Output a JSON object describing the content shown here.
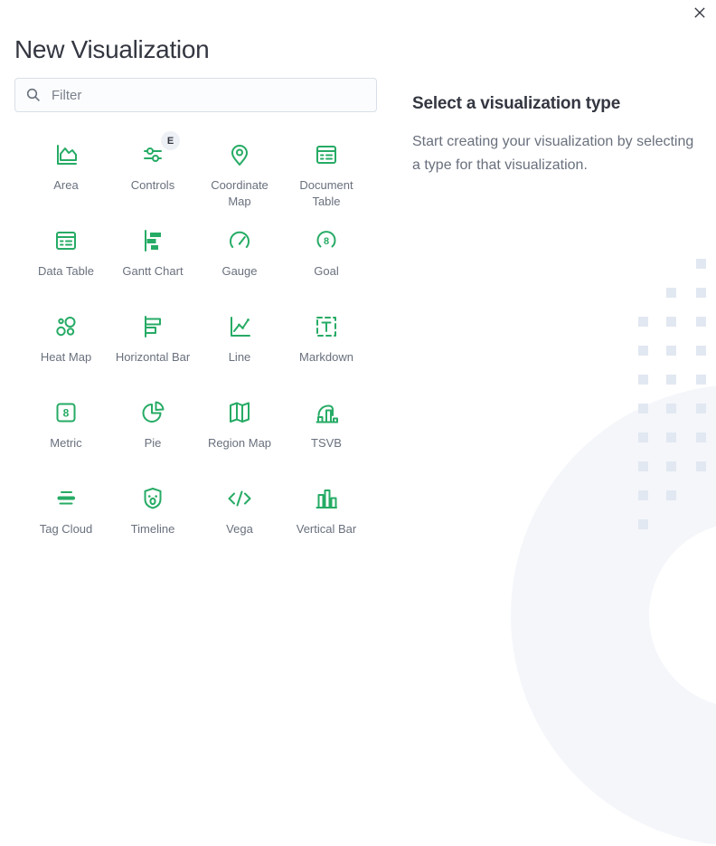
{
  "modal": {
    "title": "New Visualization",
    "close_icon": "close-icon"
  },
  "search": {
    "placeholder": "Filter",
    "value": "",
    "icon": "search-icon"
  },
  "right_panel": {
    "heading": "Select a visualization type",
    "description": "Start creating your visualization by selecting a type for that visualization."
  },
  "types": [
    {
      "label": "Area",
      "icon": "area-icon"
    },
    {
      "label": "Controls",
      "icon": "controls-icon",
      "badge": "E"
    },
    {
      "label": "Coordinate Map",
      "icon": "coordinate-map-icon"
    },
    {
      "label": "Document Table",
      "icon": "document-table-icon"
    },
    {
      "label": "Data Table",
      "icon": "data-table-icon"
    },
    {
      "label": "Gantt Chart",
      "icon": "gantt-chart-icon"
    },
    {
      "label": "Gauge",
      "icon": "gauge-icon"
    },
    {
      "label": "Goal",
      "icon": "goal-icon"
    },
    {
      "label": "Heat Map",
      "icon": "heat-map-icon"
    },
    {
      "label": "Horizontal Bar",
      "icon": "horizontal-bar-icon"
    },
    {
      "label": "Line",
      "icon": "line-icon"
    },
    {
      "label": "Markdown",
      "icon": "markdown-icon"
    },
    {
      "label": "Metric",
      "icon": "metric-icon"
    },
    {
      "label": "Pie",
      "icon": "pie-icon"
    },
    {
      "label": "Region Map",
      "icon": "region-map-icon"
    },
    {
      "label": "TSVB",
      "icon": "tsvb-icon"
    },
    {
      "label": "Tag Cloud",
      "icon": "tag-cloud-icon"
    },
    {
      "label": "Timeline",
      "icon": "timeline-icon"
    },
    {
      "label": "Vega",
      "icon": "vega-icon"
    },
    {
      "label": "Vertical Bar",
      "icon": "vertical-bar-icon"
    }
  ],
  "colors": {
    "accent_green": "#26ab65",
    "text_dark": "#343741",
    "text_subdued": "#69707d",
    "decor_square": "#e2e8f1",
    "decor_circle": "#f4f6fa",
    "badge_bg": "#edf0f5"
  }
}
